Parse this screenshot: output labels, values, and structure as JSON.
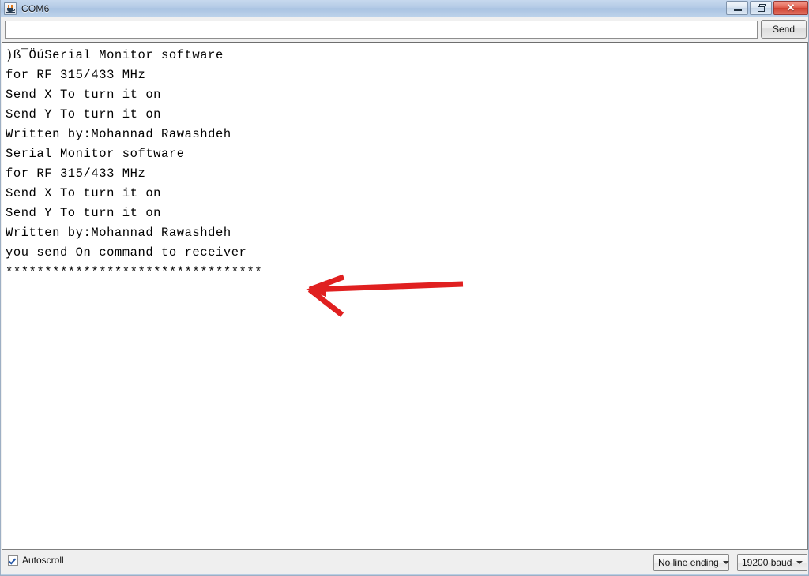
{
  "window": {
    "title": "COM6",
    "app_icon": "java-coffee-cup-icon",
    "controls": {
      "minimize_label": "–",
      "restore_label": "❐",
      "close_label": "✕"
    }
  },
  "send_bar": {
    "input_value": "",
    "input_placeholder": "",
    "send_label": "Send"
  },
  "output": {
    "lines": [
      ")ß¯ÖúSerial Monitor software",
      "for RF 315/433 MHz",
      "Send X To turn it on",
      "Send Y To turn it on",
      "Written by:Mohannad Rawashdeh",
      "Serial Monitor software",
      "for RF 315/433 MHz",
      "Send X To turn it on",
      "Send Y To turn it on",
      "Written by:Mohannad Rawashdeh",
      "you send On command to receiver",
      "*********************************"
    ],
    "text": ")ß¯ÖúSerial Monitor software\nfor RF 315/433 MHz\nSend X To turn it on\nSend Y To turn it on\nWritten by:Mohannad Rawashdeh\nSerial Monitor software\nfor RF 315/433 MHz\nSend X To turn it on\nSend Y To turn it on\nWritten by:Mohannad Rawashdeh\nyou send On command to receiver\n*********************************"
  },
  "annotation": {
    "type": "red-arrow-pointing-left",
    "color": "#e02020",
    "points_at_line": "you send On command to receiver"
  },
  "status_bar": {
    "autoscroll_label": "Autoscroll",
    "autoscroll_checked": true,
    "line_ending_value": "No line ending",
    "baud_value": "19200 baud"
  },
  "colors": {
    "titlebar_top": "#c7d9ee",
    "titlebar_bottom": "#bcd2ea",
    "close_button": "#cf4030",
    "text": "#000000",
    "background": "#f0f0f0",
    "output_background": "#ffffff",
    "annotation": "#e02020"
  }
}
